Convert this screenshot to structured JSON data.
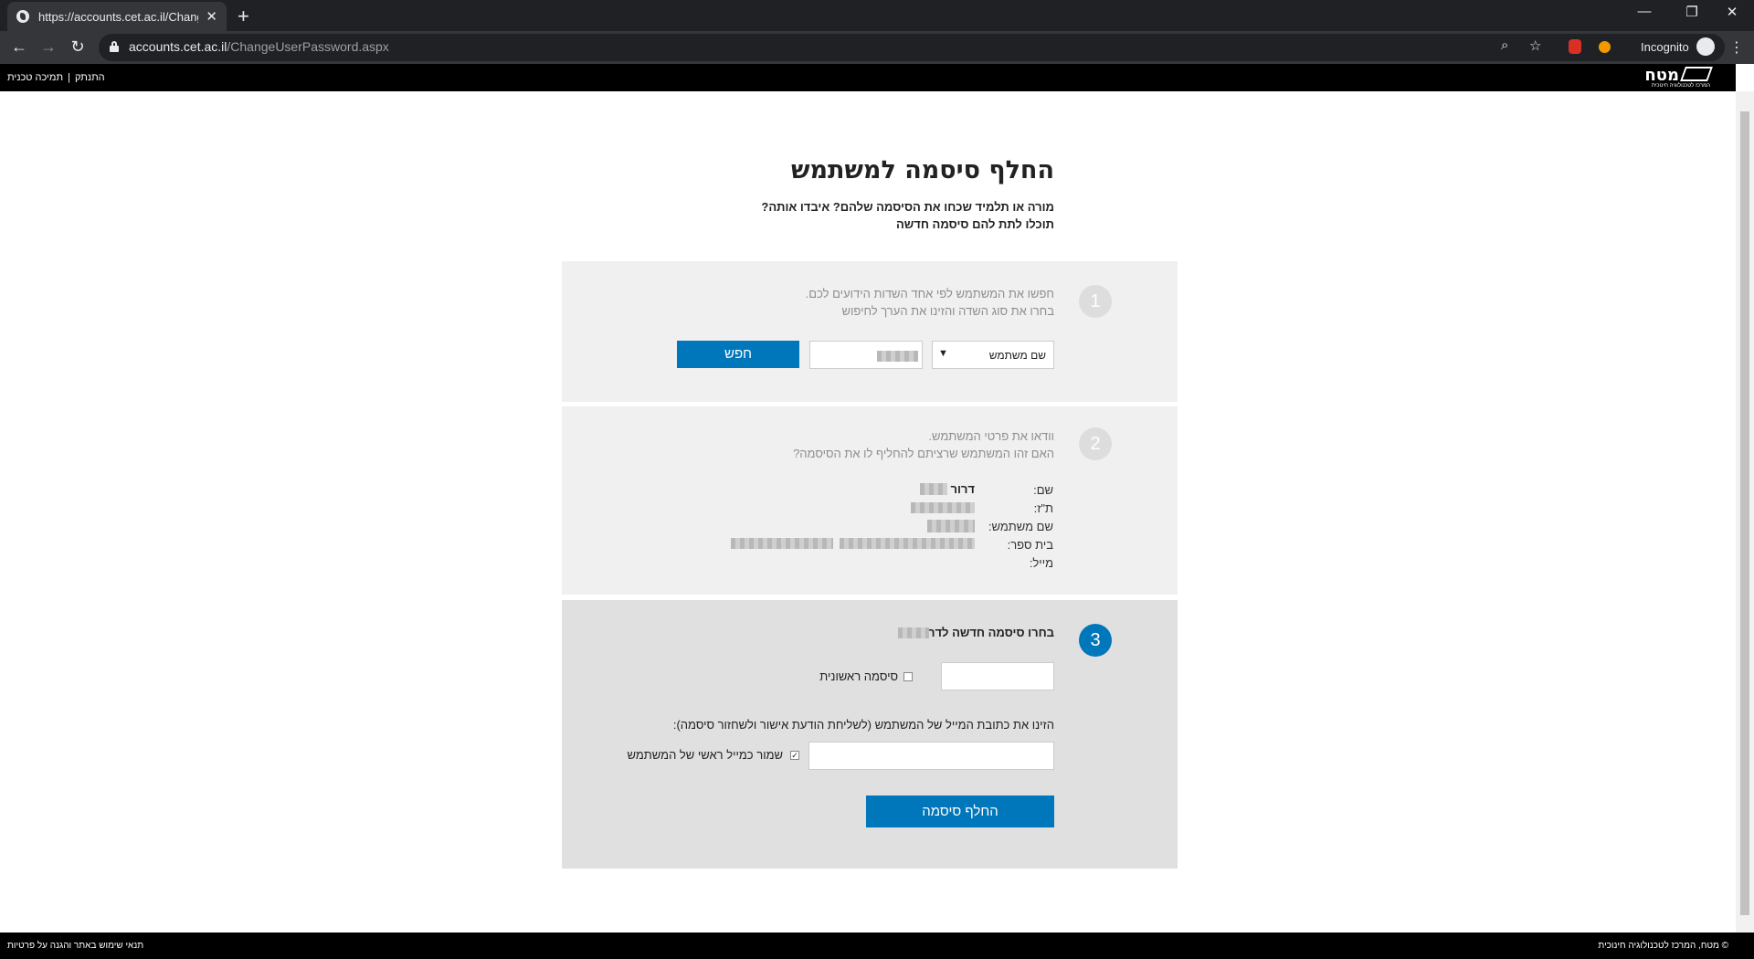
{
  "browser": {
    "tab_title": "https://accounts.cet.ac.il/ChangeUs",
    "tab_close": "✕",
    "new_tab": "+",
    "url_host": "accounts.cet.ac.il",
    "url_path": "/ChangeUserPassword.aspx",
    "incognito_label": "Incognito",
    "icons": [
      "back-icon",
      "forward-icon",
      "reload-icon",
      "lock-icon",
      "zoom-icon",
      "star-icon",
      "extension-icon",
      "menu-icon"
    ]
  },
  "site_header": {
    "logo_text": "מטח",
    "logo_tagline": "המרכז לטכנולוגיה חינוכית",
    "disconnect_link": "התנתק",
    "separator": "|",
    "support_link": "תמיכה טכנית"
  },
  "page": {
    "title": "החלף סיסמה למשתמש",
    "intro_line1": "מורה או תלמיד שכחו את הסיסמה שלהם? איבדו אותה?",
    "intro_line2": "תוכלו לתת להם סיסמה חדשה"
  },
  "step1": {
    "number": "1",
    "hint_line1": "חפשו את המשתמש לפי אחד השדות הידועים לכם.",
    "hint_line2": "בחרו את סוג השדה והזינו את הערך לחיפוש",
    "field_type_value": "שם משתמש",
    "search_button": "חפש"
  },
  "step2": {
    "number": "2",
    "hint_line1": "וודאו את פרטי המשתמש.",
    "hint_line2": "האם זהו המשתמש שרציתם להחליף לו את הסיסמה?",
    "name_label": "שם:",
    "name_value": "דרור",
    "id_label": "ת\"ז:",
    "username_label": "שם משתמש:",
    "school_label": "בית ספר:",
    "email_label": "מייל:"
  },
  "step3": {
    "number": "3",
    "title": "בחרו סיסמה חדשה לדרור",
    "initial_password_label": "סיסמה ראשונית",
    "email_prompt": "הזינו את כתובת המייל של המשתמש (לשליחת הודעת אישור ולשחזור סיסמה):",
    "save_primary_email_label": "שמור כמייל ראשי של המשתמש",
    "save_primary_checked": true,
    "change_password_button": "החלף סיסמה"
  },
  "footer": {
    "terms": "תנאי שימוש באתר והגנה על פרטיות",
    "copyright": "© מטח, המרכז לטכנולוגיה חינוכית"
  },
  "colors": {
    "accent": "#0077bb",
    "header_bg": "#000000",
    "section_bg": "#f0f0f0",
    "active_section_bg": "#e0e0e0"
  }
}
